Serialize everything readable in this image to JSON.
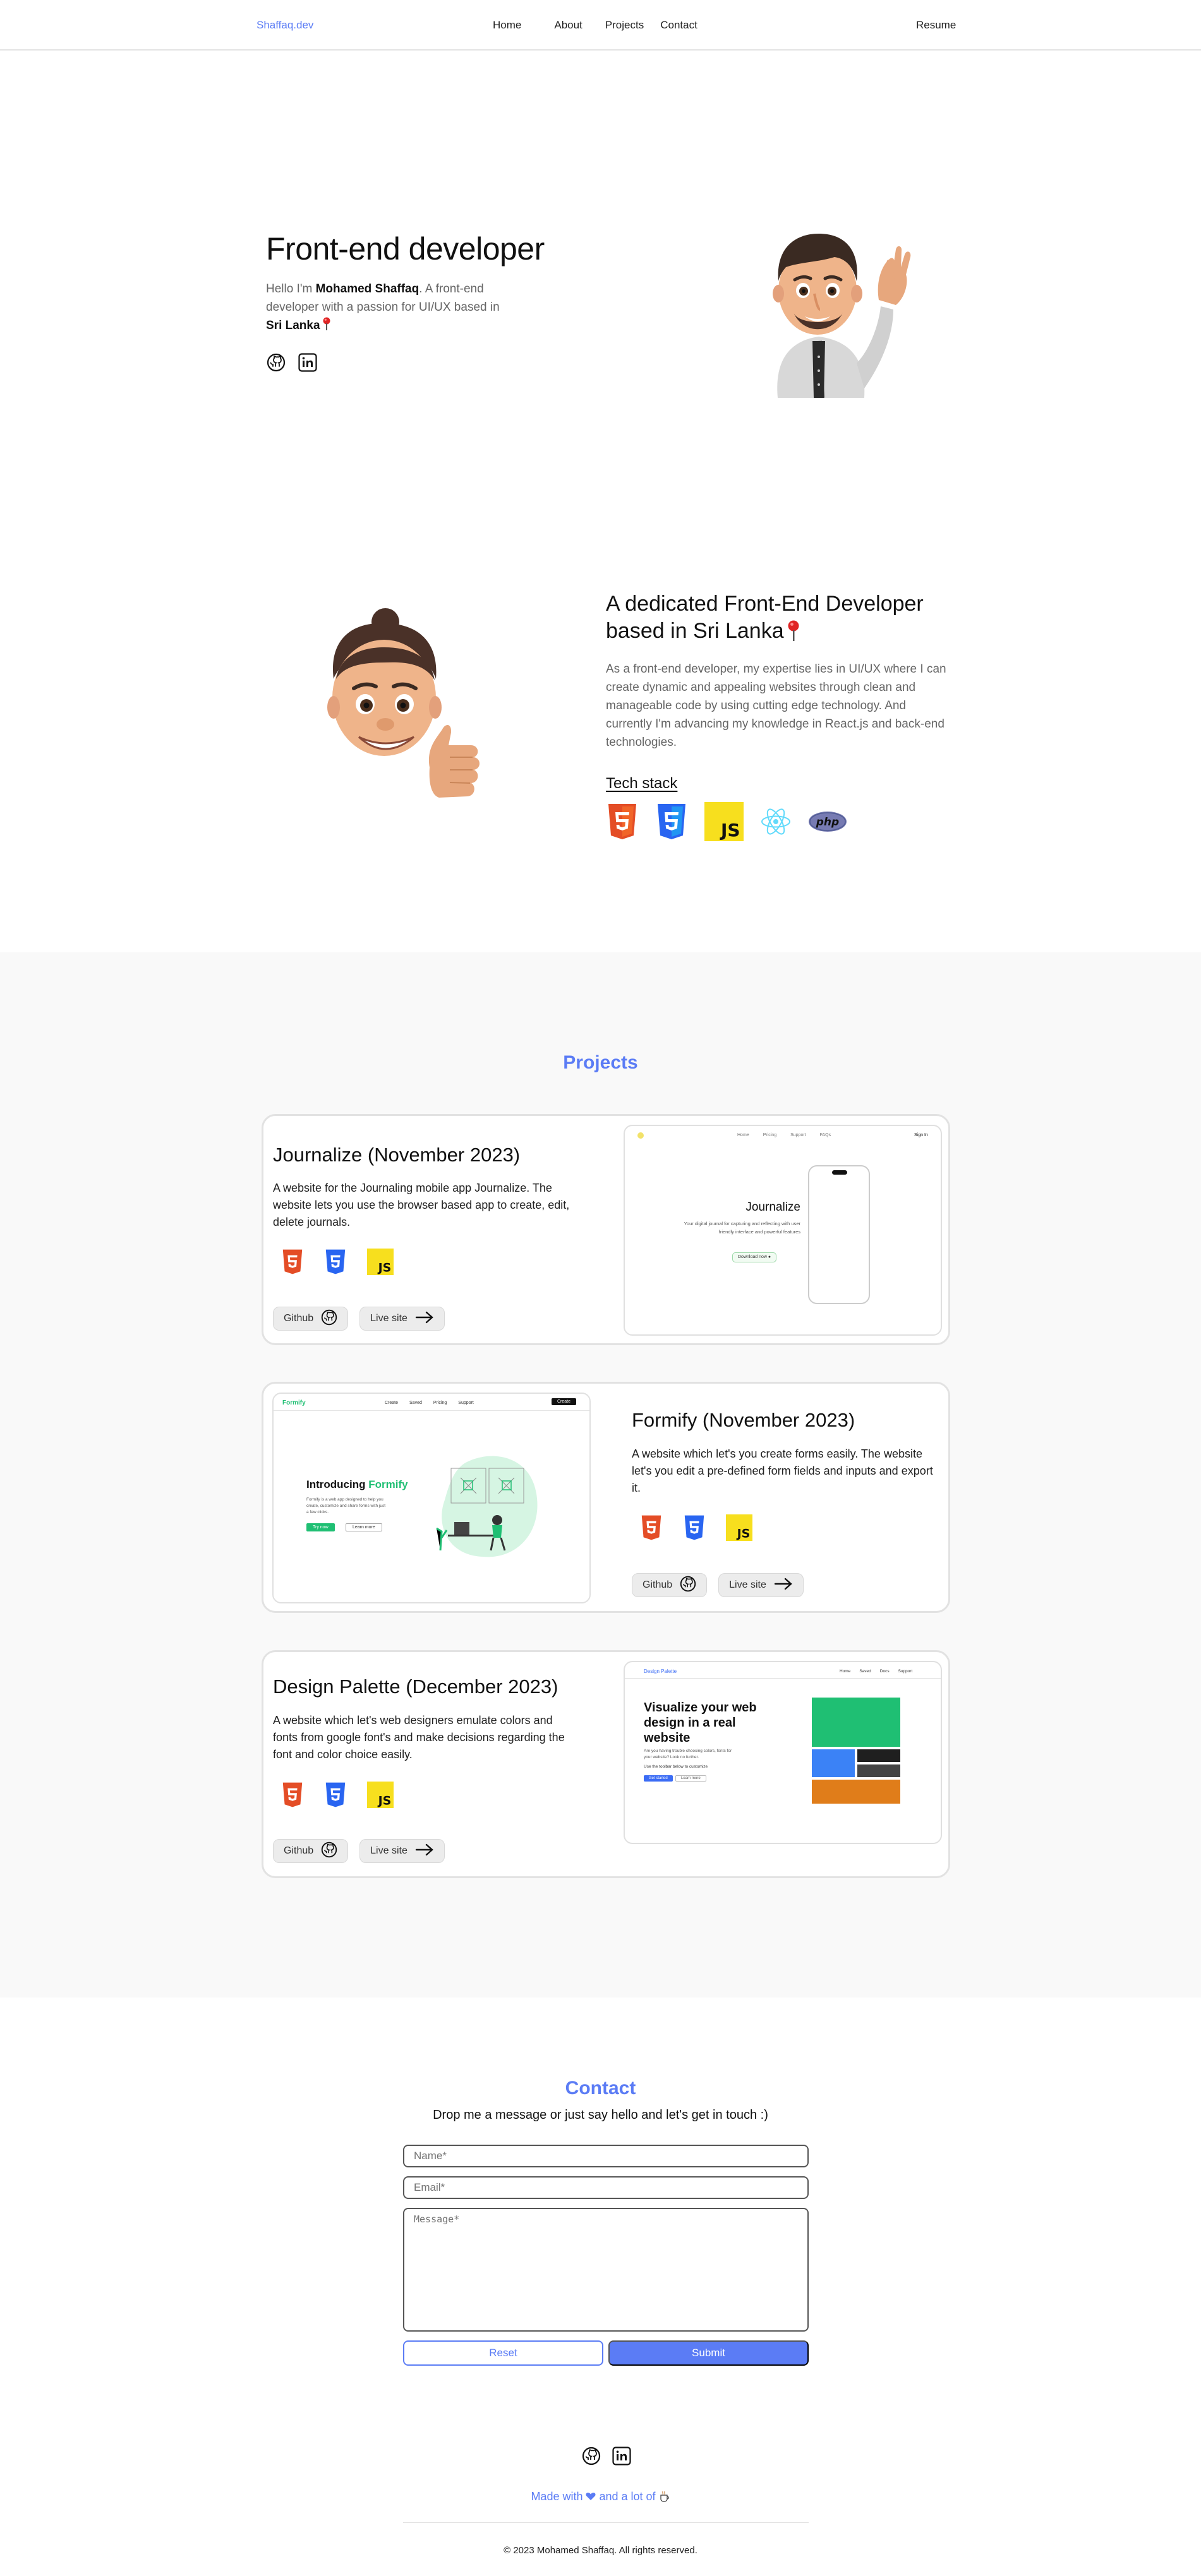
{
  "nav": {
    "brand": "Shaffaq.dev",
    "links": [
      "Home",
      "About",
      "Projects",
      "Contact"
    ],
    "resume": "Resume"
  },
  "hero": {
    "title": "Front-end developer",
    "intro_prefix": "Hello I'm ",
    "name": "Mohamed Shaffaq",
    "intro_suffix": ". A front-end developer with a passion for UI/UX based in",
    "location": "Sri Lanka",
    "pin_icon": "pin-icon",
    "icons": [
      "github-icon",
      "linkedin-icon"
    ]
  },
  "about": {
    "title": "A dedicated Front-End Developer based in Sri Lanka",
    "text": "As a front-end developer, my expertise lies in UI/UX where I can create dynamic and appealing websites through clean and manageable code by using cutting edge technology. And currently I'm advancing my knowledge in React.js and back-end technologies.",
    "tech_label": "Tech stack",
    "tech": [
      "html5-icon",
      "css3-icon",
      "javascript-icon",
      "react-icon",
      "php-icon"
    ]
  },
  "projects": {
    "heading": "Projects",
    "items": [
      {
        "title": "Journalize (November 2023)",
        "description": "A website for the Journaling mobile app Journalize. The website lets you use the browser based app to create, edit, delete journals.",
        "github_label": "Github",
        "live_label": "Live site",
        "preview": {
          "nav": [
            "Home",
            "Pricing",
            "Support",
            "FAQs"
          ],
          "sign_in": "Sign In",
          "heading": "Journalize",
          "sub": "Your digital journal for capturing and reflecting with user friendly interface and powerful features",
          "button": "Download now"
        }
      },
      {
        "title": "Formify (November 2023)",
        "description": "A website which let's you create forms easily. The website let's you edit a pre-defined form fields and inputs and export it.",
        "github_label": "Github",
        "live_label": "Live site",
        "preview": {
          "brand": "Formify",
          "nav": [
            "Create",
            "Saved",
            "Pricing",
            "Support"
          ],
          "cta": "Create",
          "heading_prefix": "Introducing ",
          "heading_brand": "Formify",
          "sub": "Formify is a web app designed to help you create, customize and share forms with just a few clicks.",
          "btn1": "Try now",
          "btn2": "Learn more"
        }
      },
      {
        "title": "Design Palette (December 2023)",
        "description": "A website which let's web designers emulate colors and fonts from google font's and make decisions regarding the font and color choice easily.",
        "github_label": "Github",
        "live_label": "Live site",
        "preview": {
          "brand": "Design Palette",
          "nav": [
            "Home",
            "Saved",
            "Docs",
            "Support"
          ],
          "heading": "Visualize your web design in a real website",
          "sub": "Are you having trouble choosing colors, fonts for your website? Look no further.",
          "sub2": "Use the toolbar below to customize",
          "btn1": "Get started",
          "btn2": "Learn more",
          "colors": [
            "#1fbf73",
            "#3b82f6",
            "#1f1f1f",
            "#444444",
            "#e07d1a"
          ]
        }
      }
    ]
  },
  "contact": {
    "heading": "Contact",
    "subtitle": "Drop me a message or just say hello and let's get in touch :)",
    "name_placeholder": "Name*",
    "email_placeholder": "Email*",
    "message_placeholder": "Message*",
    "reset": "Reset",
    "submit": "Submit"
  },
  "footer": {
    "icons": [
      "github-icon",
      "linkedin-icon"
    ],
    "made_prefix": "Made with ",
    "made_mid": " and a lot of ",
    "heart_icon": "heart-icon",
    "coffee_icon": "coffee-icon",
    "copyright": "© 2023 Mohamed Shaffaq. All rights reserved."
  },
  "colors": {
    "accent": "#5b7cf5",
    "html5": "#e44d26",
    "css3": "#2965f1",
    "js": "#f7df1e",
    "react": "#61dafb",
    "php": "#777bb3"
  }
}
